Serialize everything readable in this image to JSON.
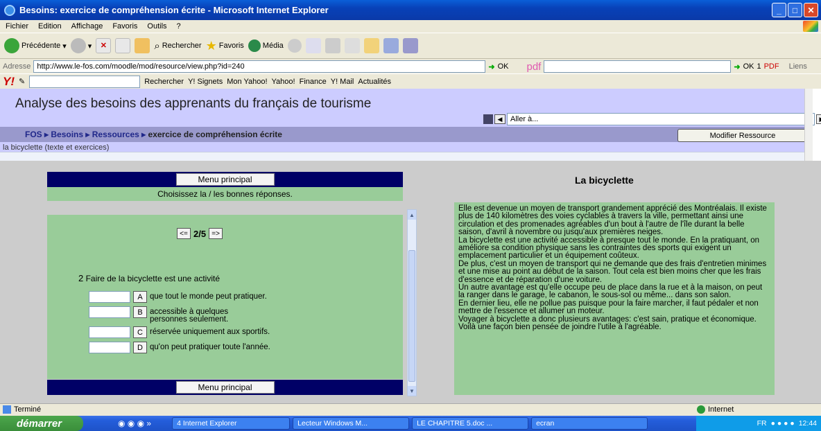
{
  "window": {
    "title": "Besoins: exercice de compréhension écrite - Microsoft Internet Explorer"
  },
  "menu": [
    "Fichier",
    "Edition",
    "Affichage",
    "Favoris",
    "Outils",
    "?"
  ],
  "toolbar": {
    "back": "Précédente",
    "search": "Rechercher",
    "favorites": "Favoris",
    "media": "Média"
  },
  "address": {
    "label": "Adresse",
    "url": "http://www.le-fos.com/moodle/mod/resource/view.php?id=240",
    "go": "OK",
    "pdf": "pdf",
    "go2": "OK",
    "count": "1",
    "pdf_btn": "PDF",
    "links": "Liens"
  },
  "yahoo": {
    "search": "Rechercher",
    "signets": "Y! Signets",
    "mon": "Mon Yahoo!",
    "yahoo": "Yahoo!",
    "finance": "Finance",
    "mail": "Y! Mail",
    "news": "Actualités"
  },
  "site": {
    "title": "Analyse des besoins des apprenants du français de tourisme",
    "jump": "Aller à...",
    "breadcrumb": [
      "FOS",
      "Besoins",
      "Ressources"
    ],
    "current": "exercice de compréhension écrite",
    "modify": "Modifier Ressource",
    "subtitle": "la bicyclette (texte et exercices)"
  },
  "exercise": {
    "menu": "Menu principal",
    "instruction": "Choisissez la / les bonnes réponses.",
    "prev": "<=",
    "next": "=>",
    "counter": "2/5",
    "qnum": "2",
    "question": "Faire de la bicyclette est une activité",
    "options": [
      {
        "letter": "A",
        "text": "que tout le monde peut pratiquer."
      },
      {
        "letter": "B",
        "text": "accessible à quelques personnes seulement."
      },
      {
        "letter": "C",
        "text": "réservée uniquement aux sportifs."
      },
      {
        "letter": "D",
        "text": "qu'on peut pratiquer toute l'année."
      }
    ]
  },
  "reading": {
    "title": "La bicyclette",
    "text": "Elle est devenue un moyen de transport grandement apprécié des Montréalais. Il existe plus de 140 kilomètres des voies cyclables à travers la ville, permettant ainsi une circulation et des promenades agréables d'un bout à l'autre de l'île durant la belle saison, d'avril à novembre ou jusqu'aux premières neiges.\nLa bicyclette est une activité accessible à presque tout le monde. En la pratiquant, on améliore sa condition physique sans les contraintes des sports qui exigent un emplacement particulier et un équipement coûteux.\nDe plus, c'est un moyen de transport qui ne demande que des frais d'entretien minimes et une mise au point au début de la saison. Tout cela est bien moins cher que les frais d'essence et de réparation d'une voiture.\nUn autre avantage est qu'elle occupe peu de place dans la rue et à la maison, on peut la ranger dans le garage, le cabanon, le sous-sol ou même... dans son salon.\nEn dernier lieu, elle ne pollue pas puisque pour la faire marcher, il faut pédaler et non mettre de l'essence et allumer un moteur.\nVoyager à bicyclette a donc plusieurs avantages: c'est sain, pratique et économique. Voilà une façon bien pensée de joindre l'utile à l'agréable."
  },
  "status": {
    "left": "Terminé",
    "right": "Internet"
  },
  "taskbar": {
    "start": "démarrer",
    "tasks": [
      "4 Internet Explorer",
      "Lecteur Windows M...",
      "LE CHAPITRE 5.doc ...",
      "ecran"
    ],
    "lang": "FR",
    "time": "12:44"
  }
}
